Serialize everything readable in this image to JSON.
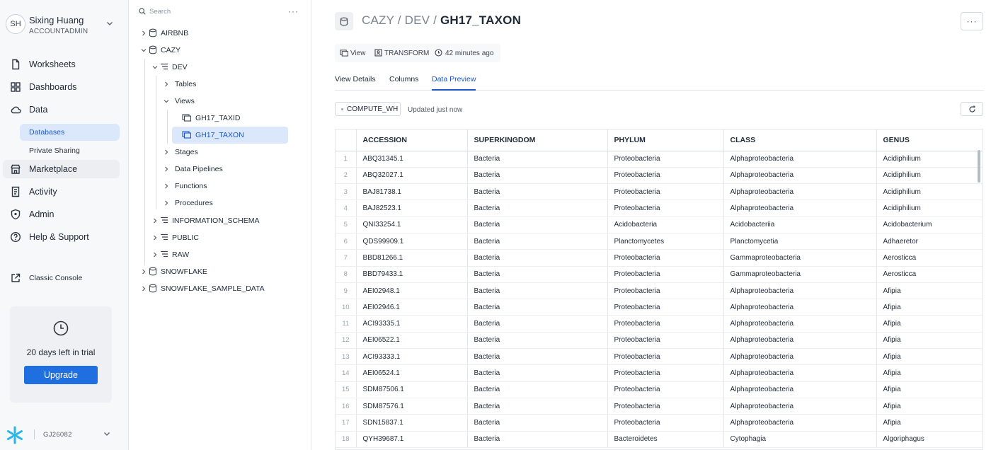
{
  "user": {
    "initials": "SH",
    "name": "Sixing Huang",
    "role": "ACCOUNTADMIN"
  },
  "nav": {
    "worksheets": "Worksheets",
    "dashboards": "Dashboards",
    "data": "Data",
    "databases": "Databases",
    "private_sharing": "Private Sharing",
    "marketplace": "Marketplace",
    "activity": "Activity",
    "admin": "Admin",
    "help": "Help & Support",
    "classic_console": "Classic Console"
  },
  "trial": {
    "text": "20 days left in trial",
    "button": "Upgrade"
  },
  "account": {
    "code": "GJ26082"
  },
  "tree": {
    "search_placeholder": "Search",
    "more": "···",
    "nodes": {
      "airbnb": "AIRBNB",
      "cazy": "CAZY",
      "dev": "DEV",
      "tables": "Tables",
      "views": "Views",
      "gh17_taxid": "GH17_TAXID",
      "gh17_taxon": "GH17_TAXON",
      "stages": "Stages",
      "data_pipelines": "Data Pipelines",
      "functions": "Functions",
      "procedures": "Procedures",
      "information_schema": "INFORMATION_SCHEMA",
      "public": "PUBLIC",
      "raw": "RAW",
      "snowflake": "SNOWFLAKE",
      "snowflake_sample_data": "SNOWFLAKE_SAMPLE_DATA"
    }
  },
  "header": {
    "breadcrumb_prefix": "CAZY / DEV / ",
    "title": "GH17_TAXON",
    "more": "···",
    "meta_type": "View",
    "meta_owner": "TRANSFORM",
    "meta_time": "42 minutes ago"
  },
  "tabs": {
    "details": "View Details",
    "columns": "Columns",
    "preview": "Data Preview"
  },
  "toolbar": {
    "warehouse": "COMPUTE_WH",
    "updated": "Updated just now"
  },
  "table": {
    "columns": [
      "ACCESSION",
      "SUPERKINGDOM",
      "PHYLUM",
      "CLASS",
      "GENUS"
    ],
    "rows": [
      [
        "1",
        "ABQ31345.1",
        "Bacteria",
        "Proteobacteria",
        "Alphaproteobacteria",
        "Acidiphilium"
      ],
      [
        "2",
        "ABQ32027.1",
        "Bacteria",
        "Proteobacteria",
        "Alphaproteobacteria",
        "Acidiphilium"
      ],
      [
        "3",
        "BAJ81738.1",
        "Bacteria",
        "Proteobacteria",
        "Alphaproteobacteria",
        "Acidiphilium"
      ],
      [
        "4",
        "BAJ82523.1",
        "Bacteria",
        "Proteobacteria",
        "Alphaproteobacteria",
        "Acidiphilium"
      ],
      [
        "5",
        "QNI33254.1",
        "Bacteria",
        "Acidobacteria",
        "Acidobacteriia",
        "Acidobacterium"
      ],
      [
        "6",
        "QDS99909.1",
        "Bacteria",
        "Planctomycetes",
        "Planctomycetia",
        "Adhaeretor"
      ],
      [
        "7",
        "BBD81266.1",
        "Bacteria",
        "Proteobacteria",
        "Gammaproteobacteria",
        "Aerosticca"
      ],
      [
        "8",
        "BBD79433.1",
        "Bacteria",
        "Proteobacteria",
        "Gammaproteobacteria",
        "Aerosticca"
      ],
      [
        "9",
        "AEI02948.1",
        "Bacteria",
        "Proteobacteria",
        "Alphaproteobacteria",
        "Afipia"
      ],
      [
        "10",
        "AEI02946.1",
        "Bacteria",
        "Proteobacteria",
        "Alphaproteobacteria",
        "Afipia"
      ],
      [
        "11",
        "ACI93335.1",
        "Bacteria",
        "Proteobacteria",
        "Alphaproteobacteria",
        "Afipia"
      ],
      [
        "12",
        "AEI06522.1",
        "Bacteria",
        "Proteobacteria",
        "Alphaproteobacteria",
        "Afipia"
      ],
      [
        "13",
        "ACI93333.1",
        "Bacteria",
        "Proteobacteria",
        "Alphaproteobacteria",
        "Afipia"
      ],
      [
        "14",
        "AEI06524.1",
        "Bacteria",
        "Proteobacteria",
        "Alphaproteobacteria",
        "Afipia"
      ],
      [
        "15",
        "SDM87506.1",
        "Bacteria",
        "Proteobacteria",
        "Alphaproteobacteria",
        "Afipia"
      ],
      [
        "16",
        "SDM87576.1",
        "Bacteria",
        "Proteobacteria",
        "Alphaproteobacteria",
        "Afipia"
      ],
      [
        "17",
        "SDN15837.1",
        "Bacteria",
        "Proteobacteria",
        "Alphaproteobacteria",
        "Afipia"
      ],
      [
        "18",
        "QYH39687.1",
        "Bacteria",
        "Bacteroidetes",
        "Cytophagia",
        "Algoriphagus"
      ]
    ]
  },
  "colors": {
    "accent": "#1a56c7",
    "button": "#1f6fe0",
    "selection": "#dbe8fb"
  }
}
